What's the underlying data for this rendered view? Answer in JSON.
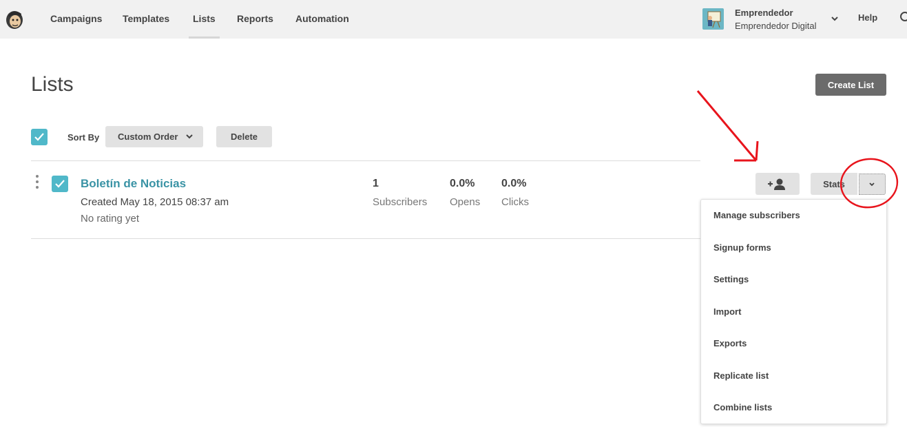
{
  "nav": {
    "items": [
      {
        "label": "Campaigns",
        "active": false
      },
      {
        "label": "Templates",
        "active": false
      },
      {
        "label": "Lists",
        "active": true
      },
      {
        "label": "Reports",
        "active": false
      },
      {
        "label": "Automation",
        "active": false
      }
    ],
    "account": {
      "name": "Emprendedor",
      "org": "Emprendedor Digital"
    },
    "help_label": "Help"
  },
  "page": {
    "title": "Lists",
    "create_label": "Create List"
  },
  "toolbar": {
    "sort_label": "Sort By",
    "sort_value": "Custom Order",
    "delete_label": "Delete"
  },
  "lists": [
    {
      "name": "Boletín de Noticias",
      "created": "Created May 18, 2015 08:37 am",
      "rating": "No rating yet",
      "subscribers": {
        "value": "1",
        "label": "Subscribers"
      },
      "opens": {
        "value": "0.0%",
        "label": "Opens"
      },
      "clicks": {
        "value": "0.0%",
        "label": "Clicks"
      },
      "stats_label": "Stats"
    }
  ],
  "dropdown": {
    "items": [
      "Manage subscribers",
      "Signup forms",
      "Settings",
      "Import",
      "Exports",
      "Replicate list",
      "Combine lists"
    ]
  },
  "colors": {
    "accent": "#50b8c9",
    "link": "#3a93a5",
    "annotation": "#e8141c"
  },
  "icons": [
    "mailchimp-logo-icon",
    "chevron-down-icon",
    "search-icon",
    "check-icon",
    "drag-handle-icon",
    "add-subscriber-icon"
  ]
}
